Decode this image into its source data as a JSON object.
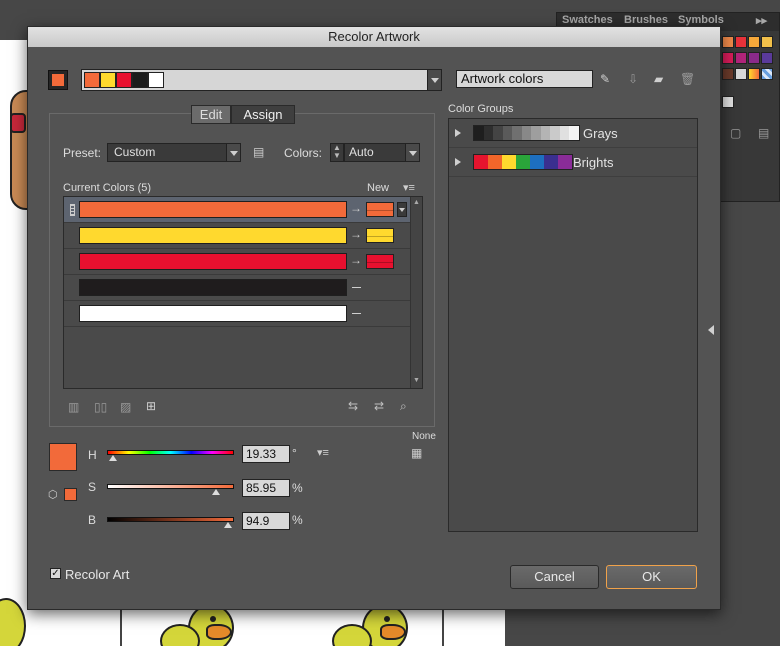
{
  "dialog": {
    "title": "Recolor Artwork"
  },
  "background_panel": {
    "tabs": [
      "Swatches",
      "Brushes",
      "Symbols"
    ],
    "menu": "▸▸"
  },
  "top": {
    "current_swatch_color": "#f26a3a",
    "strip_colors": [
      "#f26a3a",
      "#ffd92e",
      "#e8102f",
      "#1c1c1c",
      "#ffffff"
    ],
    "name_field": "Artwork colors"
  },
  "tabs": {
    "edit": "Edit",
    "assign": "Assign"
  },
  "preset": {
    "label": "Preset:",
    "value": "Custom"
  },
  "colors": {
    "label": "Colors:",
    "value": "Auto"
  },
  "list": {
    "current_header": "Current Colors (5)",
    "new_header": "New",
    "rows": [
      {
        "current": "#f26a3a",
        "new": "#f26a3a",
        "mapped": true
      },
      {
        "current": "#ffd92e",
        "new": "#ffd92e",
        "mapped": true
      },
      {
        "current": "#e8102f",
        "new": "#e8102f",
        "mapped": true
      },
      {
        "current": "#1f1c1d",
        "new": "",
        "mapped": false
      },
      {
        "current": "#ffffff",
        "new": "",
        "mapped": false
      }
    ]
  },
  "color_picker": {
    "preview_color": "#f26a3a",
    "none_label": "None",
    "h": {
      "label": "H",
      "value": "19.33",
      "unit": "°",
      "fraction": 0.05
    },
    "s": {
      "label": "S",
      "value": "85.95",
      "unit": "%",
      "fraction": 0.86
    },
    "b": {
      "label": "B",
      "value": "94.9",
      "unit": "%",
      "fraction": 0.95
    }
  },
  "color_groups": {
    "title": "Color Groups",
    "groups": [
      {
        "name": "Grays",
        "colors": [
          "#1e1e1e",
          "#2e2e2e",
          "#444",
          "#5a5a5a",
          "#707070",
          "#888",
          "#9e9e9e",
          "#b4b4b4",
          "#cacaca",
          "#e0e0e0",
          "#f4f4f4"
        ]
      },
      {
        "name": "Brights",
        "colors": [
          "#e6142e",
          "#f2662a",
          "#ffd92e",
          "#2aa53a",
          "#1d6fc0",
          "#3a2f8f",
          "#8a2c98"
        ]
      }
    ]
  },
  "recolor_art": {
    "label": "Recolor Art",
    "checked": true
  },
  "buttons": {
    "cancel": "Cancel",
    "ok": "OK"
  }
}
